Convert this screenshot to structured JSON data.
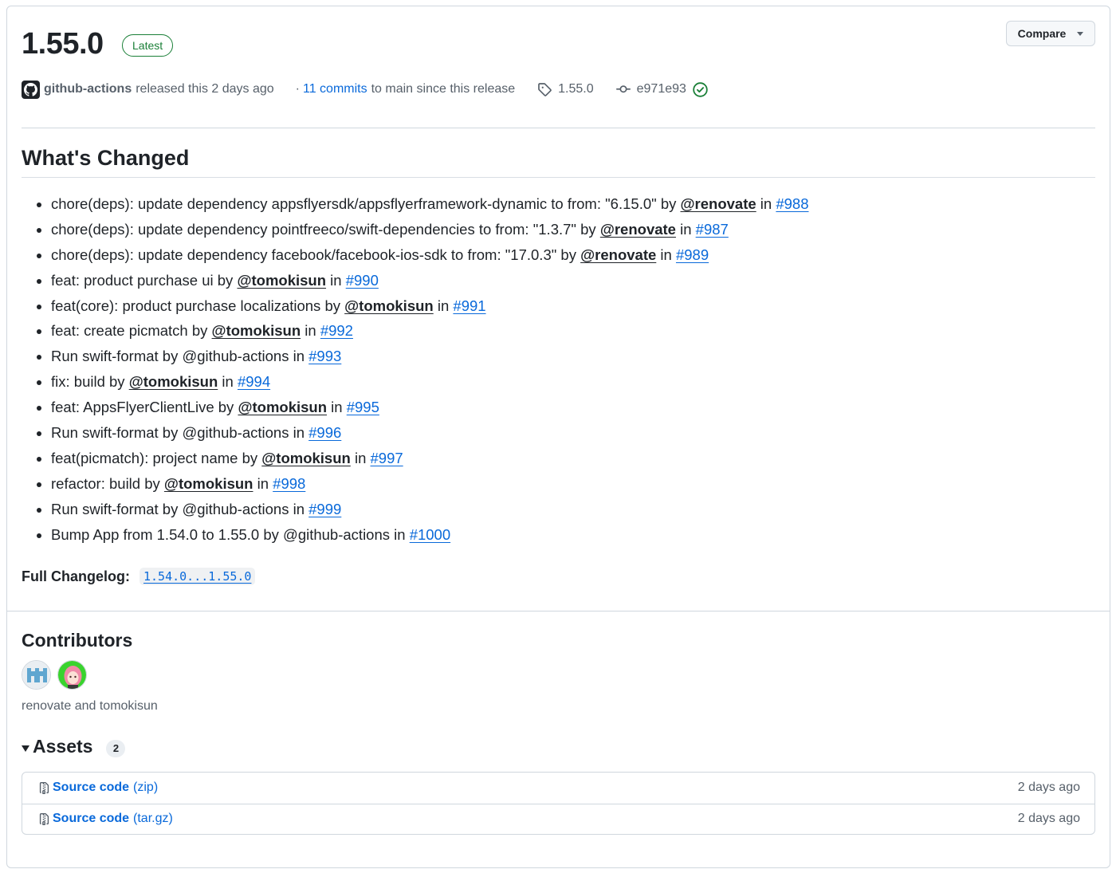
{
  "release": {
    "version": "1.55.0",
    "latest_label": "Latest",
    "compare_label": "Compare",
    "author": "github-actions",
    "released_text": "released this 2 days ago",
    "commits_prefix": "·",
    "commits_link": "11 commits",
    "commits_suffix": "to main since this release",
    "tag": "1.55.0",
    "commit": "e971e93"
  },
  "changes": {
    "heading": "What's Changed",
    "items": [
      {
        "text": "chore(deps): update dependency appsflyersdk/appsflyerframework-dynamic to from: \"6.15.0\" by ",
        "user": "@renovate",
        "in": " in ",
        "pr": "#988"
      },
      {
        "text": "chore(deps): update dependency pointfreeco/swift-dependencies to from: \"1.3.7\" by ",
        "user": "@renovate",
        "in": " in ",
        "pr": "#987"
      },
      {
        "text": "chore(deps): update dependency facebook/facebook-ios-sdk to from: \"17.0.3\" by ",
        "user": "@renovate",
        "in": " in ",
        "pr": "#989"
      },
      {
        "text": "feat: product purchase ui by ",
        "user": "@tomokisun",
        "in": " in ",
        "pr": "#990"
      },
      {
        "text": "feat(core): product purchase localizations by ",
        "user": "@tomokisun",
        "in": " in ",
        "pr": "#991"
      },
      {
        "text": "feat: create picmatch by ",
        "user": "@tomokisun",
        "in": " in ",
        "pr": "#992"
      },
      {
        "text": "Run swift-format by @github-actions in ",
        "user": "",
        "in": "",
        "pr": "#993"
      },
      {
        "text": "fix: build by ",
        "user": "@tomokisun",
        "in": " in ",
        "pr": "#994"
      },
      {
        "text": "feat: AppsFlyerClientLive by ",
        "user": "@tomokisun",
        "in": " in ",
        "pr": "#995"
      },
      {
        "text": "Run swift-format by @github-actions in ",
        "user": "",
        "in": "",
        "pr": "#996"
      },
      {
        "text": "feat(picmatch): project name by ",
        "user": "@tomokisun",
        "in": " in ",
        "pr": "#997"
      },
      {
        "text": "refactor: build by ",
        "user": "@tomokisun",
        "in": " in ",
        "pr": "#998"
      },
      {
        "text": "Run swift-format by @github-actions in ",
        "user": "",
        "in": "",
        "pr": "#999"
      },
      {
        "text": "Bump App from 1.54.0 to 1.55.0 by @github-actions in ",
        "user": "",
        "in": "",
        "pr": "#1000"
      }
    ],
    "changelog_label": "Full Changelog:",
    "changelog_link": "1.54.0...1.55.0"
  },
  "contributors": {
    "heading": "Contributors",
    "names": "renovate and tomokisun"
  },
  "assets": {
    "heading": "Assets",
    "count": "2",
    "items": [
      {
        "name": "Source code",
        "ext": "(zip)",
        "date": "2 days ago"
      },
      {
        "name": "Source code",
        "ext": "(tar.gz)",
        "date": "2 days ago"
      }
    ]
  },
  "icons": {
    "github": "github-mark-icon",
    "tag": "tag-icon",
    "commit": "git-commit-icon",
    "verified": "check-circle-icon",
    "file": "file-zip-icon"
  },
  "colors": {
    "link": "#0969da",
    "success": "#1a7f37",
    "muted": "#57606a",
    "border": "#d0d7de"
  }
}
